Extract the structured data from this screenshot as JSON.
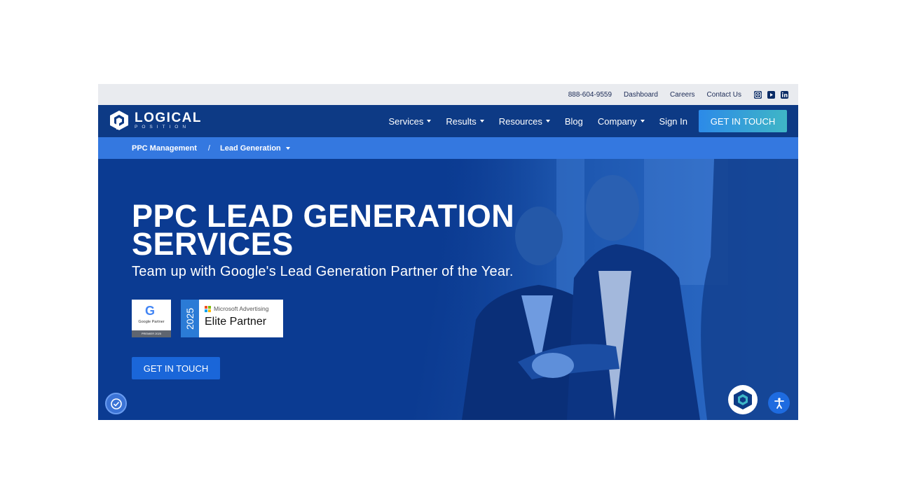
{
  "utility": {
    "phone": "888-604-9559",
    "dashboard": "Dashboard",
    "careers": "Careers",
    "contact": "Contact Us",
    "social": [
      "instagram-icon",
      "youtube-icon",
      "linkedin-icon"
    ]
  },
  "brand": {
    "name": "LOGICAL",
    "sub": "POSITION"
  },
  "nav": {
    "items": [
      {
        "label": "Services",
        "dropdown": true
      },
      {
        "label": "Results",
        "dropdown": true
      },
      {
        "label": "Resources",
        "dropdown": true
      },
      {
        "label": "Blog",
        "dropdown": false
      },
      {
        "label": "Company",
        "dropdown": true
      },
      {
        "label": "Sign In",
        "dropdown": false
      }
    ],
    "cta": "GET IN TOUCH"
  },
  "breadcrumb": {
    "items": [
      "PPC Management",
      "Lead Generation"
    ],
    "separator": "/"
  },
  "hero": {
    "title_line1": "PPC LEAD GENERATION",
    "title_line2": "SERVICES",
    "subtitle": "Team up with Google's Lead Generation Partner of the Year.",
    "cta": "GET IN TOUCH",
    "badge_google": {
      "letter": "G",
      "label": "Google Partner",
      "tier": "PREMIER 2025"
    },
    "badge_ms": {
      "year": "2025",
      "brand": "Microsoft Advertising",
      "title": "Elite Partner"
    }
  },
  "colors": {
    "nav_bg": "#0d3a85",
    "breadcrumb_bg": "#3478e0",
    "hero_bg": "#0b3b92",
    "cta_gradient_start": "#2c8ae8",
    "cta_gradient_end": "#3fb6c6",
    "utility_bg": "#e9ebef"
  }
}
